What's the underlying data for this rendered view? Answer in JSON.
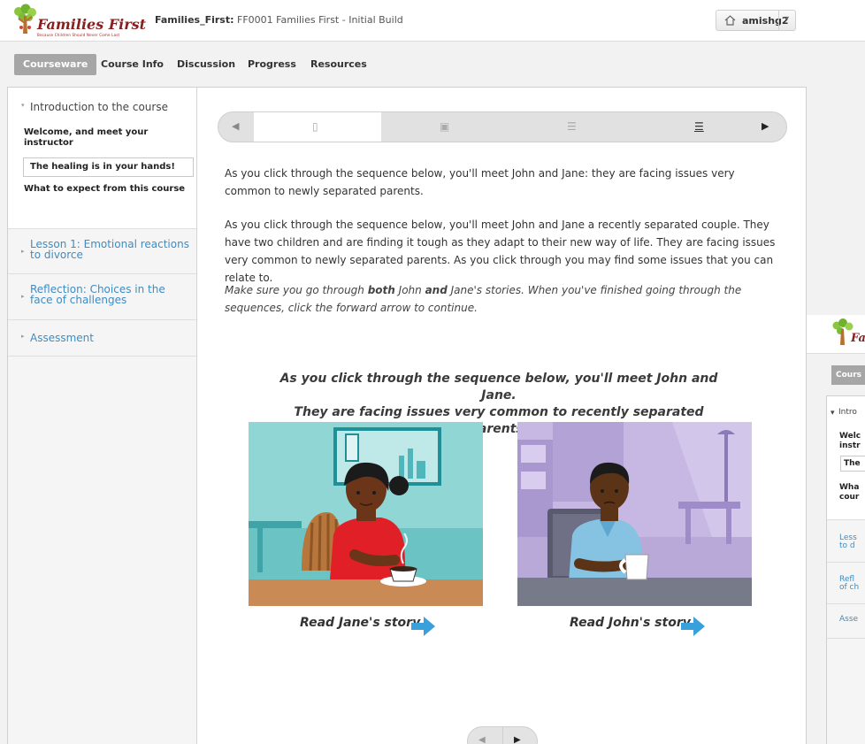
{
  "header": {
    "logo_text": "Families First",
    "logo_tagline": "Because Children Should Never Come Last",
    "course_org": "Families_First:",
    "course_name": "FF0001 Families First - Initial Build",
    "username": "amishg2"
  },
  "tabs": [
    {
      "label": "Courseware",
      "active": true
    },
    {
      "label": "Course Info"
    },
    {
      "label": "Discussion"
    },
    {
      "label": "Progress"
    },
    {
      "label": "Resources"
    }
  ],
  "sidebar": {
    "chapters": [
      {
        "title": "Introduction to the course",
        "open": true,
        "sections": [
          {
            "label": "Welcome, and meet your instructor"
          },
          {
            "label": "The healing is in your hands!",
            "current": true
          },
          {
            "label": "What to expect from this course"
          }
        ]
      },
      {
        "title": "Lesson 1: Emotional reactions to divorce"
      },
      {
        "title": "Reflection: Choices in the face of challenges"
      },
      {
        "title": "Assessment"
      }
    ]
  },
  "sequence": {
    "icons": [
      "page-icon",
      "video-icon",
      "list-icon",
      "list-underline-icon"
    ],
    "active_index": 0
  },
  "content": {
    "p1": "As you click through the sequence below, you'll meet John and Jane: they are facing issues very common to newly separated parents.",
    "p2": "As you click through the sequence below, you'll meet John and Jane a recently separated couple. They have two children and are finding it tough as they adapt to their new way of life. They are facing issues very common to newly separated parents. As you click through you may find some issues that you can relate to.",
    "note_pre": "Make sure you go through ",
    "note_b1": "both",
    "note_mid1": " John ",
    "note_b2": "and",
    "note_post": " Jane's stories. When you've finished going through the sequences, click the forward arrow to continue.",
    "headline_1": "As you click through the sequence below, you'll meet John and Jane.",
    "headline_2": "They are facing issues very common to recently separated parents.",
    "jane_link": "Read Jane's story",
    "john_link": "Read John's story"
  },
  "ghost": {
    "tab": "Cours",
    "intro": "Intro",
    "s1a": "Welc",
    "s1b": "instr",
    "s2": "The",
    "s3a": "Wha",
    "s3b": "cour",
    "l1a": "Less",
    "l1b": "to d",
    "r1a": "Refl",
    "r1b": "of ch",
    "a1": "Asse"
  },
  "colors": {
    "link": "#3d8cc4",
    "tab_active": "#a6a6a6",
    "brand": "#8a1f1f",
    "arrow": "#3aa0dc"
  }
}
